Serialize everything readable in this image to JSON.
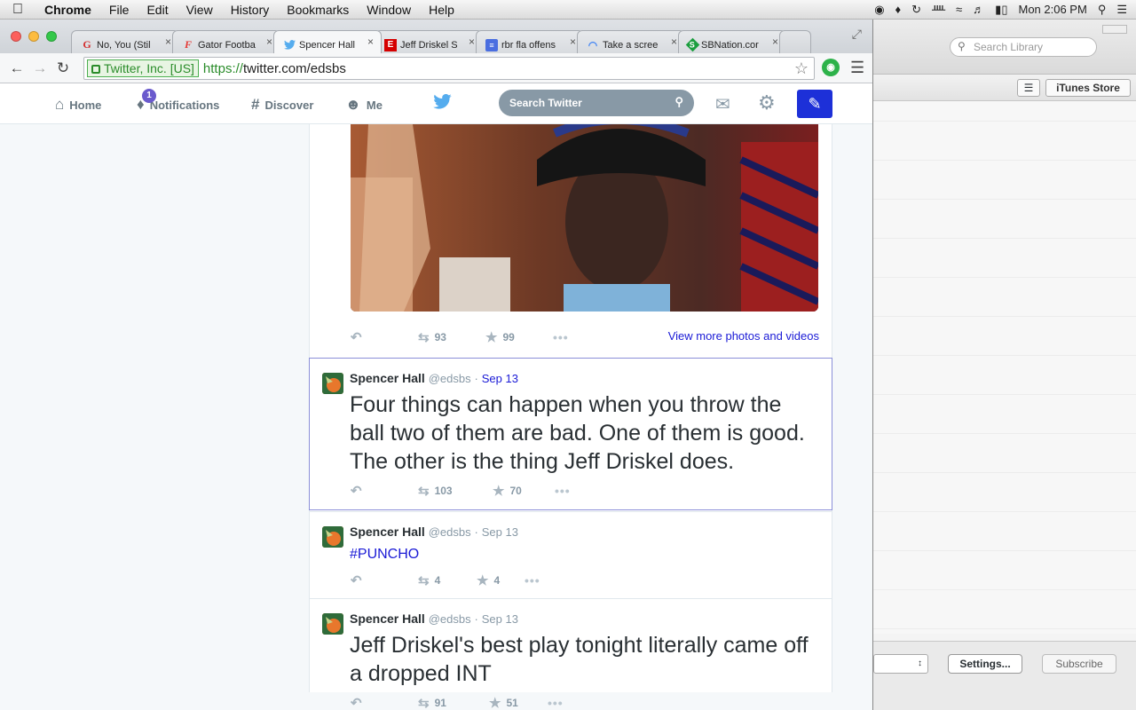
{
  "menubar": {
    "app": "Chrome",
    "items": [
      "File",
      "Edit",
      "View",
      "History",
      "Bookmarks",
      "Window",
      "Help"
    ],
    "clock": "Mon 2:06 PM"
  },
  "tabs": [
    {
      "title": "No, You (Stil",
      "favicon": "G",
      "color": "#d32f2f"
    },
    {
      "title": "Gator Footba",
      "favicon": "F",
      "color": "#e53935"
    },
    {
      "title": "Spencer Hall",
      "favicon": "twitter-bird",
      "color": "#55acee",
      "active": true
    },
    {
      "title": "Jeff Driskel S",
      "favicon": "E",
      "color": "#d50000"
    },
    {
      "title": "rbr fla offens",
      "favicon": "doc",
      "color": "#4a6ee0"
    },
    {
      "title": "Take a scree",
      "favicon": "loading",
      "color": "#4285f4"
    },
    {
      "title": "SBNation.cor",
      "favicon": "S",
      "color": "#1b9e3e"
    }
  ],
  "omnibox": {
    "ev_label": "Twitter, Inc. [US]",
    "scheme": "https://",
    "rest": "twitter.com/edsbs"
  },
  "twitter_nav": {
    "home": "Home",
    "notifications": "Notifications",
    "notification_count": "1",
    "discover": "Discover",
    "me": "Me",
    "search_placeholder": "Search Twitter"
  },
  "photo_tweet": {
    "retweets": "93",
    "favorites": "99",
    "view_more": "View more photos and videos"
  },
  "tweets": [
    {
      "name": "Spencer Hall",
      "handle": "@edsbs",
      "date": "Sep 13",
      "text": "Four things can happen when you throw the ball two of them are bad. One of them is good. The other is the thing Jeff Driskel does.",
      "retweets": "103",
      "favorites": "70"
    },
    {
      "name": "Spencer Hall",
      "handle": "@edsbs",
      "date": "Sep 13",
      "text": "#PUNCHO",
      "retweets": "4",
      "favorites": "4"
    },
    {
      "name": "Spencer Hall",
      "handle": "@edsbs",
      "date": "Sep 13",
      "text": "Jeff Driskel's best play tonight literally came off a dropped INT",
      "retweets": "91",
      "favorites": "51"
    }
  ],
  "itunes": {
    "search_placeholder": "Search Library",
    "store_button": "iTunes Store",
    "settings_button": "Settings...",
    "subscribe_button": "Subscribe"
  }
}
